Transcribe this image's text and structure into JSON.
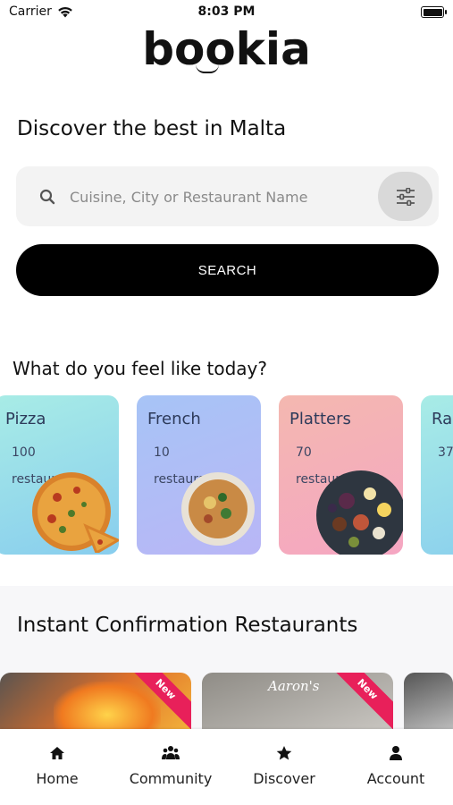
{
  "status_bar": {
    "carrier": "Carrier",
    "time": "8:03 PM"
  },
  "app": {
    "logo_text": "bookia"
  },
  "hero": {
    "headline": "Discover the best in Malta"
  },
  "search": {
    "placeholder": "Cuisine, City or Restaurant Name",
    "value": "",
    "button_label": "SEARCH"
  },
  "categories_section": {
    "title": "What do you feel like today?",
    "items": [
      {
        "name": "Pizza",
        "count": "100 restaurants",
        "gradient": [
          "#a8ece6",
          "#88cdee"
        ]
      },
      {
        "name": "French",
        "count": "10 restaurants",
        "gradient": [
          "#a7c4f6",
          "#b9b6f6"
        ]
      },
      {
        "name": "Platters",
        "count": "70 restaurants",
        "gradient": [
          "#f4b8b0",
          "#f5a6c2"
        ]
      },
      {
        "name": "Ra",
        "count": "37",
        "gradient": [
          "#a8ece6",
          "#88cdee"
        ]
      }
    ]
  },
  "instant_section": {
    "title": "Instant Confirmation Restaurants",
    "cards": [
      {
        "badge": "New",
        "name": ""
      },
      {
        "badge": "New",
        "name": "Aaron's"
      },
      {
        "badge": "",
        "name": ""
      }
    ]
  },
  "tab_bar": {
    "items": [
      {
        "label": "Home",
        "icon": "home-icon"
      },
      {
        "label": "Community",
        "icon": "community-icon"
      },
      {
        "label": "Discover",
        "icon": "star-icon"
      },
      {
        "label": "Account",
        "icon": "person-icon"
      }
    ]
  },
  "colors": {
    "accent": "#000000",
    "badge": "#e8205a",
    "search_bg": "#f3f3f3"
  }
}
